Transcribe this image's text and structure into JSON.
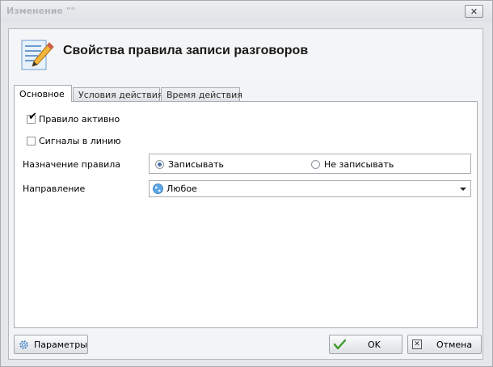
{
  "window": {
    "title": "Изменение \"\""
  },
  "header": {
    "title": "Свойства правила записи разговоров"
  },
  "tabs": [
    {
      "label": "Основное"
    },
    {
      "label": "Условия действия"
    },
    {
      "label": "Время действия"
    }
  ],
  "form": {
    "active_checkbox": {
      "label": "Правило активно",
      "checked": true
    },
    "signals_checkbox": {
      "label": "Сигналы в линию",
      "checked": false
    },
    "purpose": {
      "label": "Назначение правила",
      "options": [
        {
          "label": "Записывать",
          "selected": true
        },
        {
          "label": "Не записывать",
          "selected": false
        }
      ]
    },
    "direction": {
      "label": "Направление",
      "value": "Любое"
    }
  },
  "buttons": {
    "params": "Параметры",
    "ok": "OK",
    "cancel": "Отмена"
  },
  "colors": {
    "accent": "#4a6fa5",
    "ok_check": "#3c9a2e"
  }
}
